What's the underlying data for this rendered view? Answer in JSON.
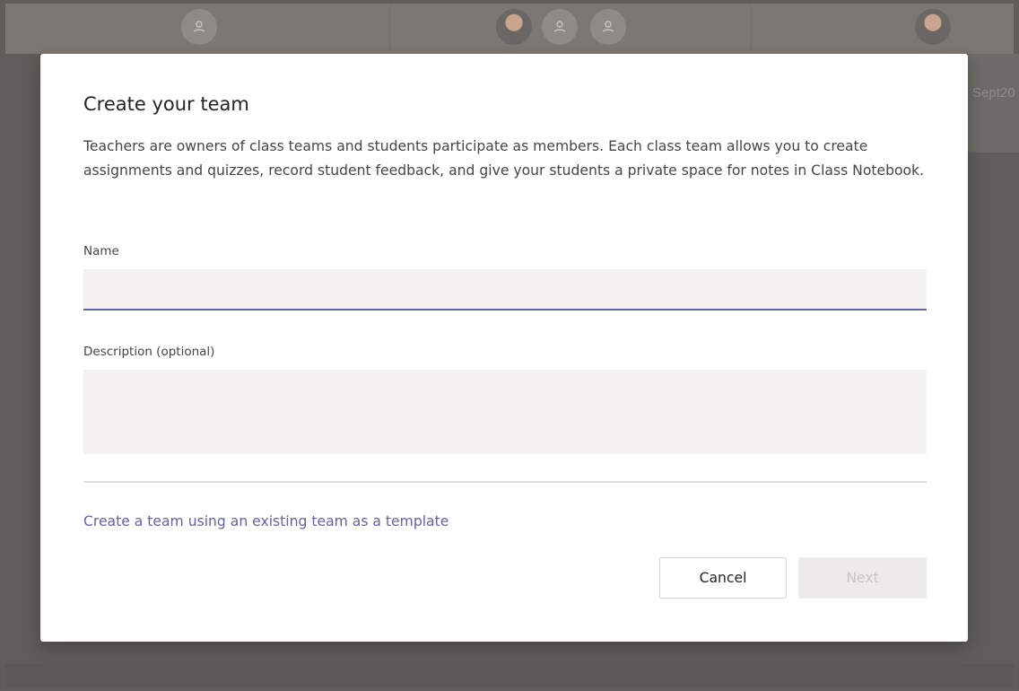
{
  "background": {
    "right_text": "Sept20"
  },
  "dialog": {
    "title": "Create your team",
    "intro": "Teachers are owners of class teams and students participate as members. Each class team allows you to create assignments and quizzes, record student feedback, and give your students a private space for notes in Class Notebook.",
    "name_label": "Name",
    "name_value": "",
    "description_label": "Description (optional)",
    "description_value": "",
    "template_link": "Create a team using an existing team as a template",
    "cancel_label": "Cancel",
    "next_label": "Next"
  },
  "colors": {
    "accent": "#6264a7",
    "overlay": "#5f5c5a",
    "input_bg": "#f3f2f1",
    "disabled_bg": "#edebe9",
    "disabled_text": "#c8c6c4"
  },
  "icons": {
    "default_avatar": "person-silhouette-icon",
    "photo_avatar": "user-photo-avatar"
  }
}
